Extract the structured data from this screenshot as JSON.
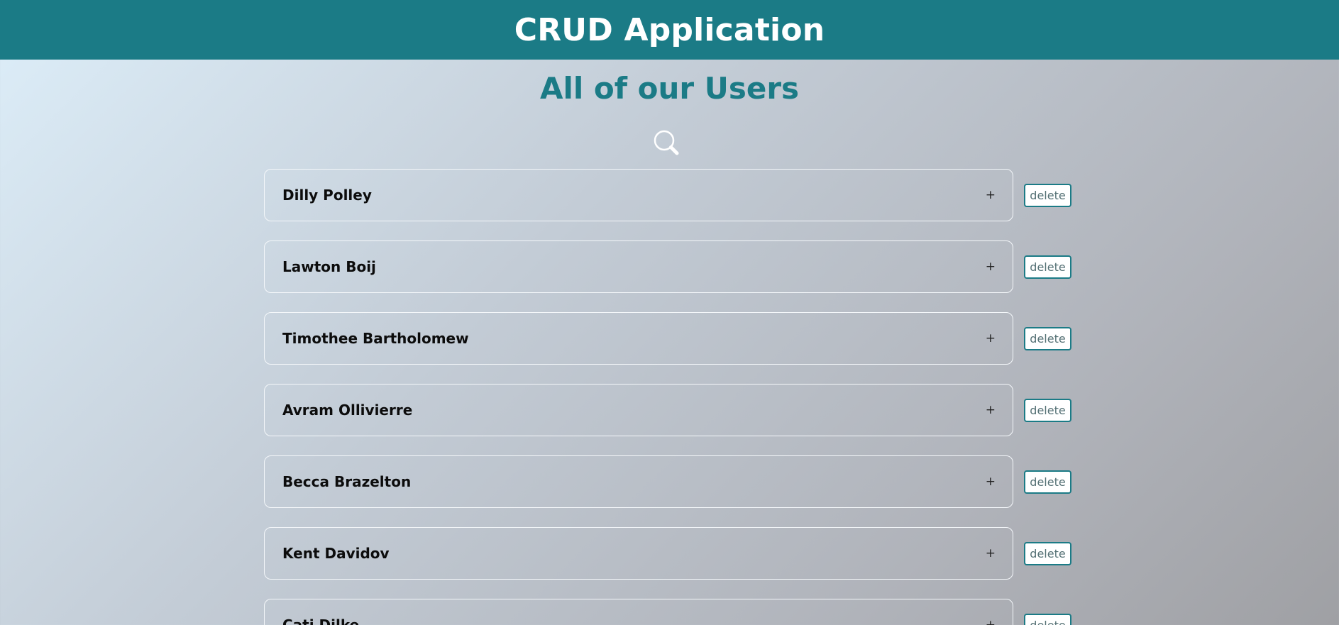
{
  "header": {
    "title": "CRUD Application"
  },
  "main": {
    "title": "All of our Users",
    "search_icon": "search-icon",
    "users": [
      {
        "name": "Dilly Polley",
        "expand": "+",
        "delete_label": "delete"
      },
      {
        "name": "Lawton Boij",
        "expand": "+",
        "delete_label": "delete"
      },
      {
        "name": "Timothee Bartholomew",
        "expand": "+",
        "delete_label": "delete"
      },
      {
        "name": "Avram Ollivierre",
        "expand": "+",
        "delete_label": "delete"
      },
      {
        "name": "Becca Brazelton",
        "expand": "+",
        "delete_label": "delete"
      },
      {
        "name": "Kent Davidov",
        "expand": "+",
        "delete_label": "delete"
      },
      {
        "name": "Cati Dilke",
        "expand": "+",
        "delete_label": "delete"
      }
    ]
  },
  "colors": {
    "header_bg": "#1b7b86",
    "title": "#1b7b86",
    "delete_border": "#1b7b86",
    "card_border": "#f4f7fa"
  }
}
